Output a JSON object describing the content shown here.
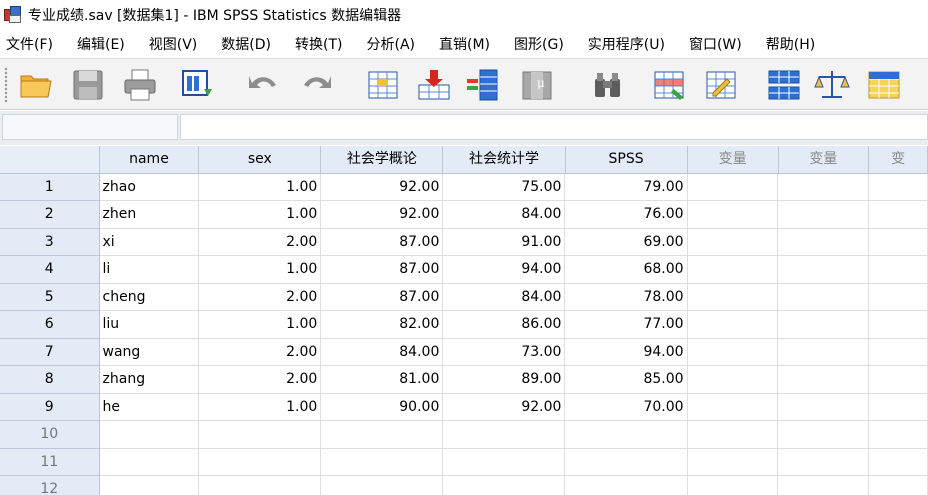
{
  "window": {
    "title": "专业成绩.sav [数据集1] - IBM SPSS Statistics 数据编辑器"
  },
  "menu": [
    {
      "label": "文件(F)"
    },
    {
      "label": "编辑(E)"
    },
    {
      "label": "视图(V)"
    },
    {
      "label": "数据(D)"
    },
    {
      "label": "转换(T)"
    },
    {
      "label": "分析(A)"
    },
    {
      "label": "直销(M)"
    },
    {
      "label": "图形(G)"
    },
    {
      "label": "实用程序(U)"
    },
    {
      "label": "窗口(W)"
    },
    {
      "label": "帮助(H)"
    }
  ],
  "toolbar": [
    {
      "icon": "open-folder-icon"
    },
    {
      "icon": "save-icon"
    },
    {
      "icon": "print-icon"
    },
    {
      "icon": "dialog-recall-icon"
    },
    {
      "icon": "undo-icon"
    },
    {
      "icon": "redo-icon"
    },
    {
      "icon": "goto-case-icon"
    },
    {
      "icon": "goto-variable-icon"
    },
    {
      "icon": "variables-icon"
    },
    {
      "icon": "run-descriptives-icon"
    },
    {
      "icon": "find-icon"
    },
    {
      "icon": "insert-cases-icon"
    },
    {
      "icon": "insert-variable-icon"
    },
    {
      "icon": "split-file-icon"
    },
    {
      "icon": "weight-cases-icon"
    },
    {
      "icon": "select-cases-icon"
    }
  ],
  "refbar": {
    "cell_ref": "",
    "cell_value": ""
  },
  "grid": {
    "columns": [
      "name",
      "sex",
      "社会学概论",
      "社会统计学",
      "SPSS",
      "变量",
      "变量",
      "变"
    ],
    "rows": [
      {
        "num": "1",
        "name": "zhao",
        "sex": "1.00",
        "c1": "92.00",
        "c2": "75.00",
        "spss": "79.00"
      },
      {
        "num": "2",
        "name": "zhen",
        "sex": "1.00",
        "c1": "92.00",
        "c2": "84.00",
        "spss": "76.00"
      },
      {
        "num": "3",
        "name": "xi",
        "sex": "2.00",
        "c1": "87.00",
        "c2": "91.00",
        "spss": "69.00"
      },
      {
        "num": "4",
        "name": "li",
        "sex": "1.00",
        "c1": "87.00",
        "c2": "94.00",
        "spss": "68.00"
      },
      {
        "num": "5",
        "name": "cheng",
        "sex": "2.00",
        "c1": "87.00",
        "c2": "84.00",
        "spss": "78.00"
      },
      {
        "num": "6",
        "name": "liu",
        "sex": "1.00",
        "c1": "82.00",
        "c2": "86.00",
        "spss": "77.00"
      },
      {
        "num": "7",
        "name": "wang",
        "sex": "2.00",
        "c1": "84.00",
        "c2": "73.00",
        "spss": "94.00"
      },
      {
        "num": "8",
        "name": "zhang",
        "sex": "2.00",
        "c1": "81.00",
        "c2": "89.00",
        "spss": "85.00"
      },
      {
        "num": "9",
        "name": "he",
        "sex": "1.00",
        "c1": "90.00",
        "c2": "92.00",
        "spss": "70.00"
      },
      {
        "num": "10",
        "name": "",
        "sex": "",
        "c1": "",
        "c2": "",
        "spss": ""
      },
      {
        "num": "11",
        "name": "",
        "sex": "",
        "c1": "",
        "c2": "",
        "spss": ""
      },
      {
        "num": "12",
        "name": "",
        "sex": "",
        "c1": "",
        "c2": "",
        "spss": ""
      }
    ]
  }
}
